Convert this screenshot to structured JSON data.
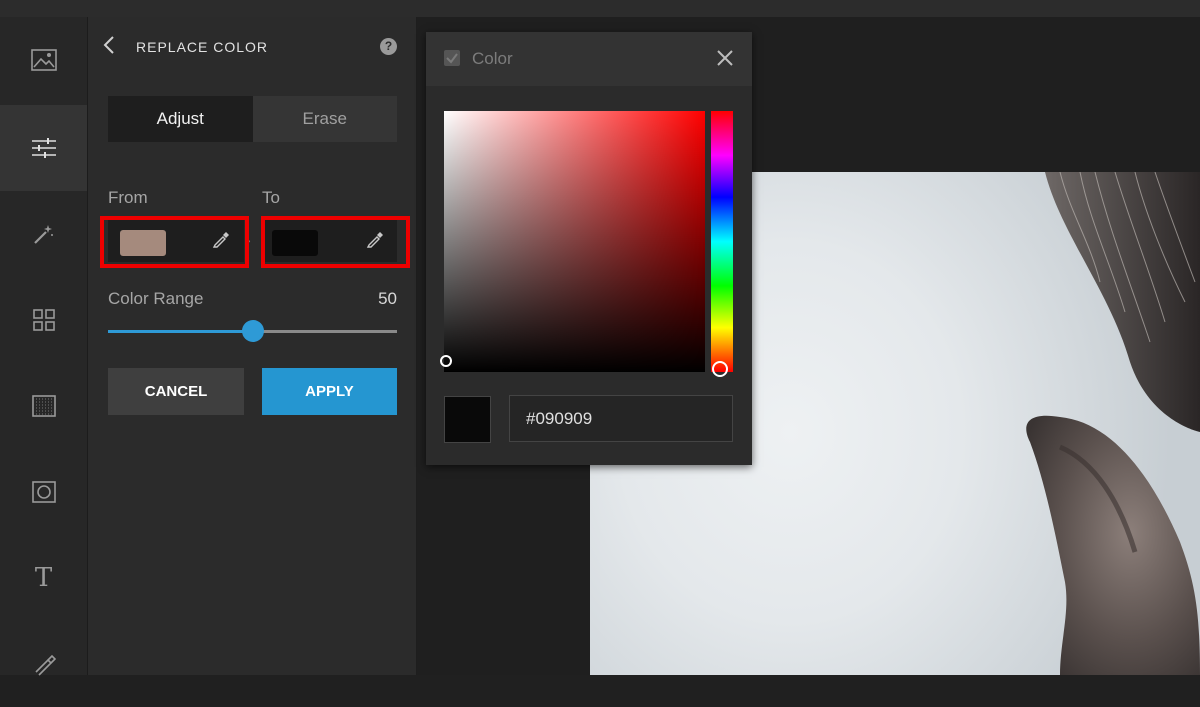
{
  "panel": {
    "title": "REPLACE COLOR",
    "help_label": "?",
    "tabs": [
      {
        "label": "Adjust",
        "active": true
      },
      {
        "label": "Erase",
        "active": false
      }
    ],
    "from_label": "From",
    "to_label": "To",
    "from_color": "#a58a7d",
    "to_color": "#090909",
    "color_range_label": "Color Range",
    "color_range_value": "50",
    "color_range_fraction": 0.5,
    "cancel_label": "CANCEL",
    "apply_label": "APPLY"
  },
  "sidebar": {
    "items": [
      {
        "icon": "image-icon",
        "active": false
      },
      {
        "icon": "sliders-icon",
        "active": true
      },
      {
        "icon": "magic-wand-icon",
        "active": false
      },
      {
        "icon": "grid-icon",
        "active": false
      },
      {
        "icon": "texture-icon",
        "active": false
      },
      {
        "icon": "frame-icon",
        "active": false
      },
      {
        "icon": "text-icon",
        "active": false
      },
      {
        "icon": "brush-icon",
        "active": false
      }
    ],
    "text_icon_glyph": "T"
  },
  "color_dialog": {
    "title": "Color",
    "hex_value": "#090909",
    "preview_color": "#090909",
    "hue_color": "#ff0000"
  },
  "colors": {
    "accent": "#2596d1",
    "highlight": "#ee0000"
  }
}
